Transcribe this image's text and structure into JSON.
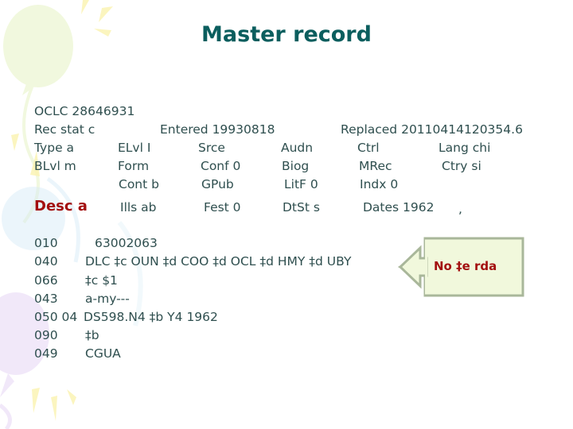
{
  "title": "Master record",
  "header": {
    "oclc": "OCLC 28646931",
    "rows": [
      [
        "Rec stat c",
        "Entered 19930818",
        "Replaced 20110414120354.6"
      ],
      [
        "Type a",
        "ELvl I",
        "Srce",
        "Audn",
        "Ctrl",
        "Lang chi"
      ],
      [
        "BLvl m",
        "Form",
        "Conf 0",
        "Biog",
        "MRec",
        "Ctry si"
      ],
      [
        "Cont b",
        "GPub",
        "LitF 0",
        "Indx 0"
      ],
      [
        "Ills ab",
        "Fest 0",
        "DtSt s",
        "Dates 1962",
        ","
      ]
    ],
    "desc": "Desc a"
  },
  "fields": [
    {
      "tag": "010",
      "value": "63002063"
    },
    {
      "tag": "040",
      "value": "DLC ‡c OUN ‡d COO ‡d OCL ‡d HMY ‡d UBY"
    },
    {
      "tag": "066",
      "value": "‡c $1"
    },
    {
      "tag": "043",
      "value": "a-my---"
    },
    {
      "tag": "050 04",
      "value": "DS598.N4 ‡b Y4 1962"
    },
    {
      "tag": "090",
      "value": "‡b"
    },
    {
      "tag": "049",
      "value": "CGUA"
    }
  ],
  "callout": {
    "text": "No ‡e rda",
    "icon": "left-arrow-callout"
  },
  "colors": {
    "title": "#0b5e5e",
    "text": "#2f4f4f",
    "highlight": "#a30f0f",
    "callout_fill": "#f1f8dc",
    "callout_border": "#a9b79a"
  }
}
